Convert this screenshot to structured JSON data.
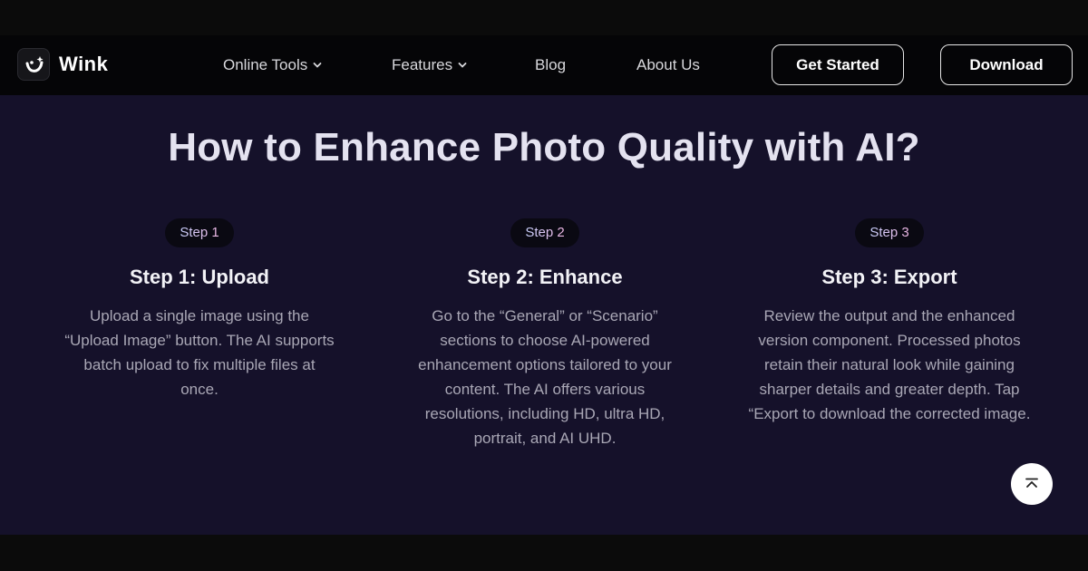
{
  "header": {
    "logo_text": "Wink",
    "nav": [
      {
        "label": "Online Tools",
        "has_dropdown": true
      },
      {
        "label": "Features",
        "has_dropdown": true
      },
      {
        "label": "Blog",
        "has_dropdown": false
      },
      {
        "label": "About Us",
        "has_dropdown": false
      }
    ],
    "get_started_label": "Get Started",
    "download_label": "Download"
  },
  "main": {
    "title": "How to Enhance Photo Quality with AI?",
    "steps": [
      {
        "badge": "Step 1",
        "title": "Step 1: Upload",
        "description": "Upload a single image using the “Upload Image” button. The AI supports batch upload to fix multiple files at once."
      },
      {
        "badge": "Step 2",
        "title": "Step 2: Enhance",
        "description": "Go to the “General” or “Scenario” sections to choose AI-powered enhancement options tailored to your content. The AI offers various resolutions, including HD, ultra HD, portrait, and AI UHD."
      },
      {
        "badge": "Step 3",
        "title": "Step 3: Export",
        "description": "Review the output and the enhanced version component. Processed photos retain their natural look while gaining sharper details and greater depth. Tap “Export to download the corrected image."
      }
    ]
  },
  "icons": {
    "logo": "wink-logo-icon",
    "dropdown": "chevron-down-icon",
    "scroll_top": "arrow-up-to-top-icon"
  },
  "colors": {
    "section_bg": "#15112a",
    "nav_bg": "#050507",
    "badge_gradient_start": "#c9d2ff",
    "badge_gradient_end": "#f1b8e6"
  }
}
